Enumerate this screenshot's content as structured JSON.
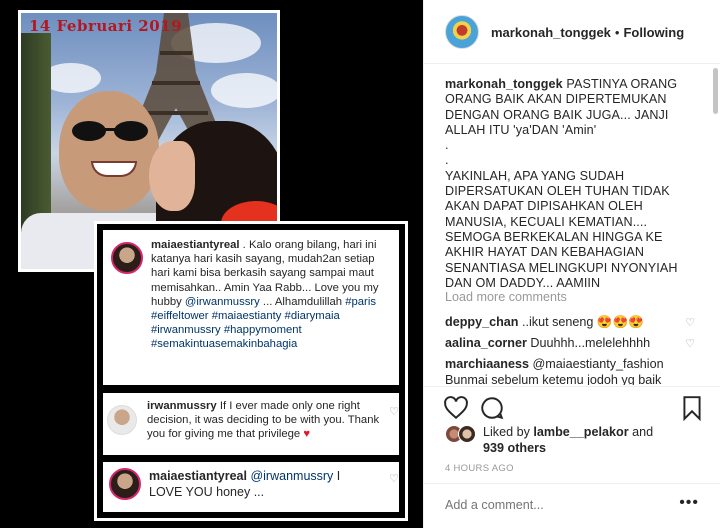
{
  "photo": {
    "date_stamp": "14 Februari 2019"
  },
  "card": {
    "post_user": "maiaestiantyreal",
    "post_text_1": " . Kalo orang bilang, hari ini katanya hari kasih sayang, mudah2an setiap hari kami bisa berkasih sayang sampai maut memisahkan.. Amin Yaa Rabb... Love you my hubby ",
    "post_mention": "@irwanmussry",
    "post_text_2": " ... Alhamdulillah ",
    "post_tags": "#paris #eiffeltower #maiaestianty #diarymaia #irwanmussry #happymoment #semakintuasemakinbahagia",
    "reply_user": "irwanmussry",
    "reply_text": " If I ever made only one right decision, it was deciding to be with you. Thank you for giving me that privilege ",
    "reply2_user": "maiaestiantyreal",
    "reply2_mention": "@irwanmussry",
    "reply2_text": " I LOVE YOU honey ..."
  },
  "panel": {
    "username": "markonah_tonggek",
    "follow_status": "Following",
    "caption_user": "markonah_tonggek",
    "caption_p1": " PASTINYA ORANG ORANG BAIK AKAN DIPERTEMUKAN DENGAN ORANG BAIK JUGA... JANJI ALLAH ITU 'ya'DAN 'Amin'",
    "caption_dot1": ".",
    "caption_dot2": ".",
    "caption_p2": "YAKINLAH, APA YANG SUDAH DIPERSATUKAN OLEH TUHAN TIDAK AKAN DAPAT DIPISAHKAN OLEH MANUSIA, KECUALI KEMATIAN.... SEMOGA BERKEKALAN HINGGA KE AKHIR HAYAT DAN KEBAHAGIAN SENANTIASA MELINGKUPI NYONYIAH DAN OM DADDY... AAMIIN",
    "load_more": "Load more comments",
    "comments": [
      {
        "user": "deppy_chan",
        "text": " ..ikut seneng 😍😍😍"
      },
      {
        "user": "aalina_corner",
        "text": " Duuhhh...melelehhhh"
      },
      {
        "user": "marchiaaness",
        "text": " @maiaestianty_fashion Bunmai sebelum ketemu jodoh yg baik"
      }
    ],
    "liked_by_prefix": "Liked by ",
    "liked_by_user": "lambe__pelakor",
    "liked_by_and": " and ",
    "liked_by_count": "939 others",
    "timestamp": "4 HOURS AGO",
    "add_comment_placeholder": "Add a comment...",
    "more": "•••"
  },
  "colors": {
    "link": "#003569",
    "stamp_red": "#b3171f",
    "heart_red": "#e0192b"
  },
  "icons": [
    "heart-icon",
    "comment-icon",
    "bookmark-icon",
    "more-icon"
  ]
}
